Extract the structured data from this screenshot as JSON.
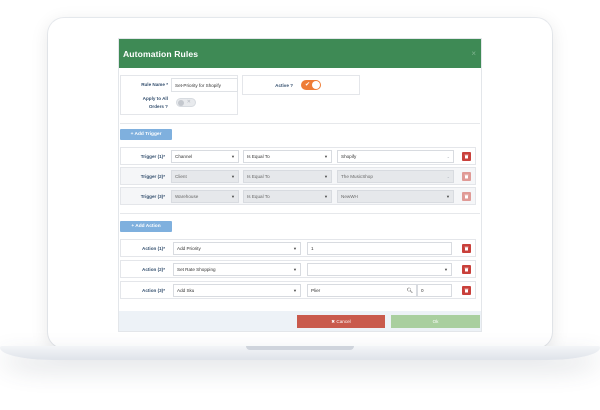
{
  "modal": {
    "title": "Automation Rules",
    "close": "×"
  },
  "rule": {
    "name_label": "Rule Name *",
    "name_value": "Set-Priority for Shopify",
    "apply_label_line1": "Apply to All",
    "apply_label_line2": "Orders ?",
    "active_label": "Active ?",
    "active_on": true,
    "apply_all_on": false
  },
  "triggers": {
    "add_label": "+ Add Trigger",
    "rows": [
      {
        "label": "Trigger (1)*",
        "field": "Channel",
        "operator": "Is Equal To",
        "value": "Shopify",
        "disabled": false
      },
      {
        "label": "Trigger (2)*",
        "field": "Client",
        "operator": "Is Equal To",
        "value": "The MusicShop",
        "disabled": true
      },
      {
        "label": "Trigger (3)*",
        "field": "Warehouse",
        "operator": "Is Equal To",
        "value": "NewWH",
        "disabled": true
      }
    ]
  },
  "actions": {
    "add_label": "+ Add Action",
    "rows": [
      {
        "label": "Action (1)*",
        "type": "Add Priority",
        "value": "1"
      },
      {
        "label": "Action (2)*",
        "type": "Set Rate Shopping",
        "value": ""
      },
      {
        "label": "Action (3)*",
        "type": "Add Sku",
        "value": "Plier",
        "qty": "0"
      }
    ]
  },
  "footer": {
    "cancel_label": "✖ Cancel",
    "ok_label": "Ok"
  },
  "colors": {
    "header": "#3e8a55",
    "toggle_on": "#ee7c36",
    "delete": "#c9403b",
    "add_button": "#7fb0de",
    "cancel": "#c95a4c",
    "ok": "#a9cf9f"
  }
}
